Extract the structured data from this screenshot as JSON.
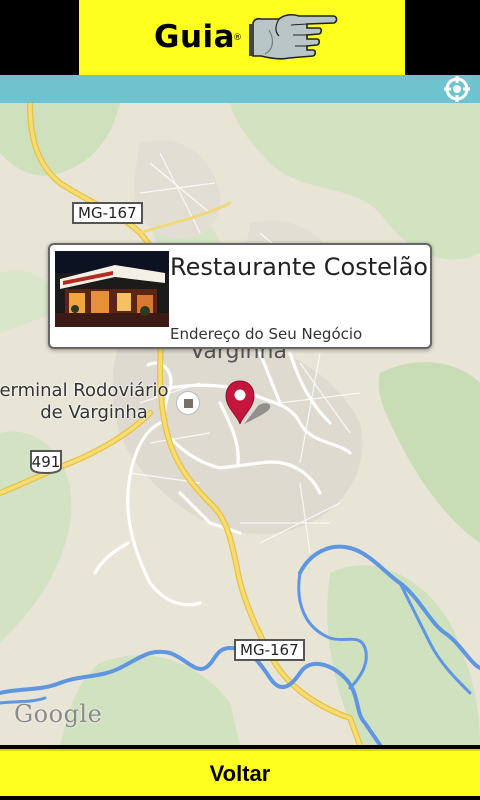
{
  "header": {
    "logo_text": "Guia",
    "logo_mark": "®",
    "logo_icon": "pointing-hand-icon"
  },
  "toolbar": {
    "locate_icon": "my-location-icon"
  },
  "map": {
    "city_label": "Varginha",
    "terminal_label_line1": "erminal Rodoviário",
    "terminal_label_line2": "de Varginha",
    "road_top": "MG-167",
    "road_bottom": "MG-167",
    "route_491": "491",
    "attribution": "Google"
  },
  "info_window": {
    "title": "Restaurante Costelão",
    "subtitle": "Endereço do Seu Negócio"
  },
  "footer": {
    "back_label": "Voltar"
  },
  "colors": {
    "brand_yellow": "#ffff1f",
    "map_strip": "#6fc3cf",
    "pin_red": "#c4163c",
    "water": "#6a9fe0",
    "highway": "#f5d35a"
  }
}
